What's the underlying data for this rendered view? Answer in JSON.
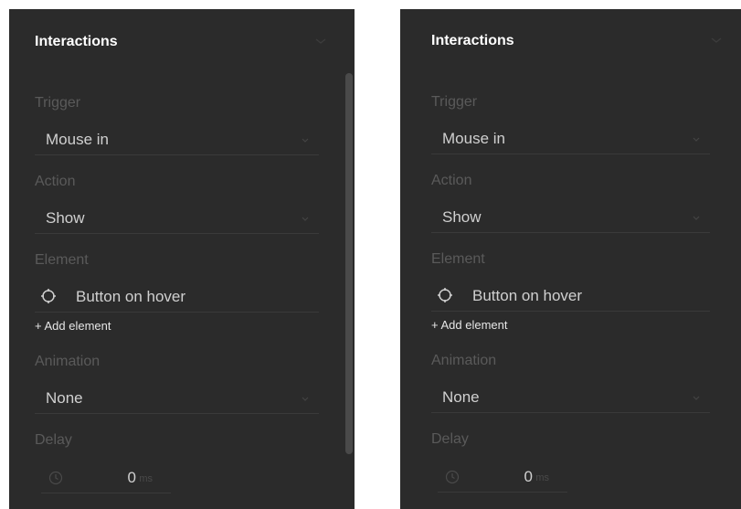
{
  "panels": [
    {
      "header": "Interactions",
      "trigger": {
        "label": "Trigger",
        "value": "Mouse in"
      },
      "action": {
        "label": "Action",
        "value": "Show"
      },
      "element": {
        "label": "Element",
        "value": "Button on hover",
        "add_label": "+ Add element"
      },
      "animation": {
        "label": "Animation",
        "value": "None"
      },
      "delay": {
        "label": "Delay",
        "value": "0",
        "unit": "ms"
      }
    },
    {
      "header": "Interactions",
      "trigger": {
        "label": "Trigger",
        "value": "Mouse in"
      },
      "action": {
        "label": "Action",
        "value": "Show"
      },
      "element": {
        "label": "Element",
        "value": "Button on hover",
        "add_label": "+ Add element"
      },
      "animation": {
        "label": "Animation",
        "value": "None"
      },
      "delay": {
        "label": "Delay",
        "value": "0",
        "unit": "ms"
      }
    }
  ],
  "colors": {
    "panel_bg": "#2b2b2b",
    "section_label": "#5a5a5a",
    "value_text": "#d0d0d0",
    "header_text": "#ffffff"
  },
  "icons": [
    "chevron-down-icon",
    "target-icon",
    "clock-icon"
  ]
}
